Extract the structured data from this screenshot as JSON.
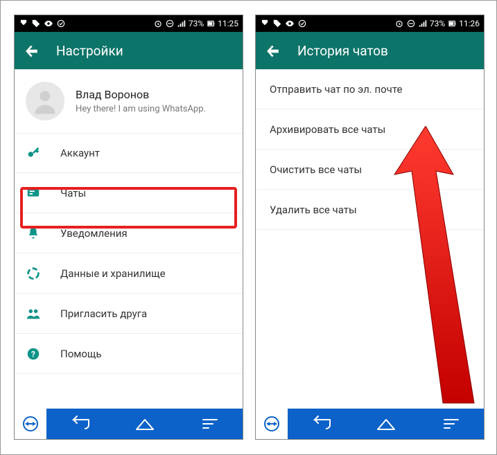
{
  "statusbar_left": {
    "battery_pct": "73%",
    "time": "11:25"
  },
  "statusbar_right": {
    "battery_pct": "73%",
    "time": "11:26"
  },
  "left": {
    "header_title": "Настройки",
    "profile": {
      "name": "Влад Воронов",
      "status": "Hey there! I am using WhatsApp."
    },
    "items": [
      {
        "label": "Аккаунт"
      },
      {
        "label": "Чаты"
      },
      {
        "label": "Уведомления"
      },
      {
        "label": "Данные и хранилище"
      },
      {
        "label": "Пригласить друга"
      },
      {
        "label": "Помощь"
      }
    ]
  },
  "right": {
    "header_title": "История чатов",
    "items": [
      {
        "label": "Отправить чат по эл. почте"
      },
      {
        "label": "Архивировать все чаты"
      },
      {
        "label": "Очистить все чаты"
      },
      {
        "label": "Удалить все чаты"
      }
    ]
  },
  "colors": {
    "accent": "#0d9488",
    "header": "#0d7469",
    "bottom": "#0d62c9",
    "highlight": "#e52020"
  }
}
